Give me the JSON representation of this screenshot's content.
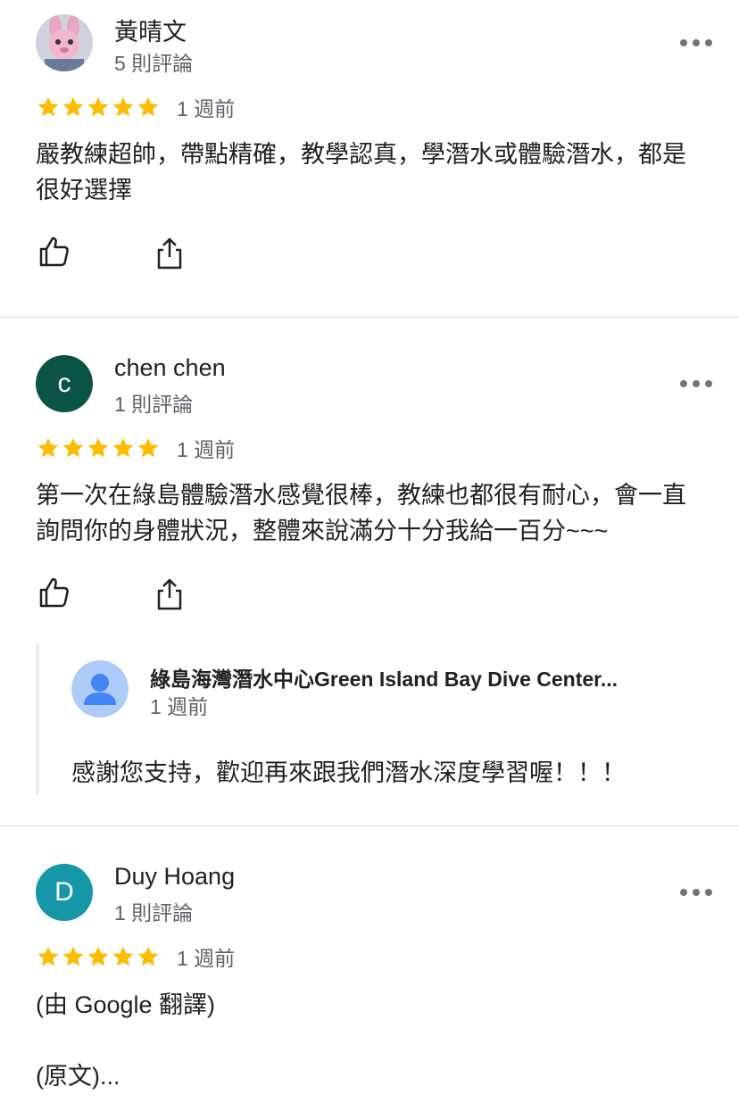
{
  "reviews": [
    {
      "name": "黃晴文",
      "review_count": "5 則評論",
      "rating": 5,
      "when": "1 週前",
      "text": "嚴教練超帥，帶點精確，教學認真，學潛水或體驗潛水，都是很好選擇",
      "avatar_icon": "pink-bunny-photo"
    },
    {
      "name": "chen chen",
      "review_count": "1 則評論",
      "rating": 5,
      "when": "1 週前",
      "text": "第一次在綠島體驗潛水感覺很棒，教練也都很有耐心，會一直詢問你的身體狀況，整體來說滿分十分我給一百分~~~",
      "avatar_letter": "c",
      "avatar_color": "#0b5345",
      "owner_reply": {
        "name": "綠島海灣潛水中心Green Island Bay Dive Center...",
        "when": "1 週前",
        "text": "感謝您支持，歡迎再來跟我們潛水深度學習喔！！！"
      }
    },
    {
      "name": "Duy Hoang",
      "review_count": "1 則評論",
      "rating": 5,
      "when": "1 週前",
      "text_line1": "(由 Google 翻譯)",
      "text_line2": "(原文)...",
      "avatar_letter": "D",
      "avatar_color": "#1597a7"
    }
  ],
  "colors": {
    "star": "#fbbc04",
    "divider": "#dadce0",
    "secondary_text": "#5f6368"
  }
}
